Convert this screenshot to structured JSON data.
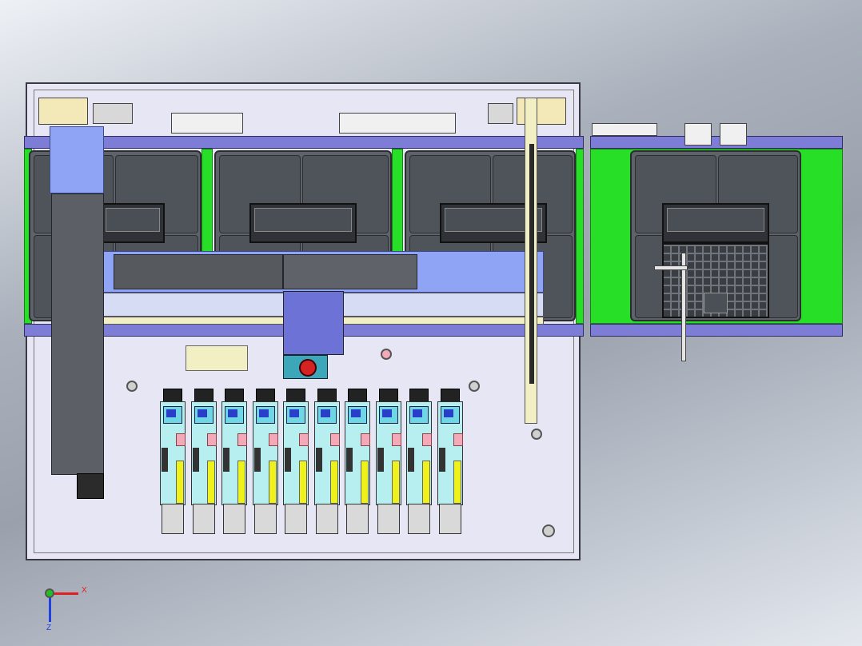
{
  "viewport": {
    "triad": {
      "x_label": "X",
      "z_label": "Z",
      "x_color": "#e02020",
      "y_color": "#20c020",
      "z_color": "#2040e0"
    }
  },
  "model": {
    "plate_color": "#e6e6f4",
    "rail_color": "#7d7dd8",
    "belt_color": "#27df27",
    "gantry_color": "#8fa4f5",
    "module_count": 10,
    "bay_count": 4,
    "laptop_count": 4
  }
}
